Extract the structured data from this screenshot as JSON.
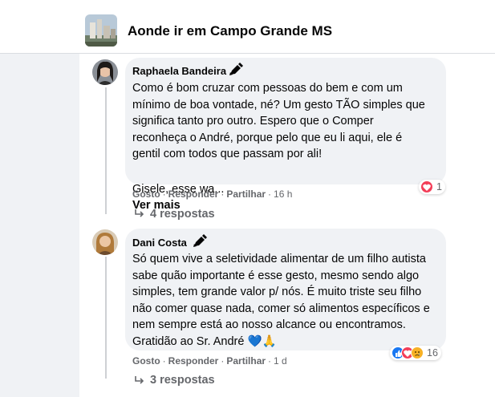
{
  "header": {
    "group_title": "Aonde ir em Campo Grande MS"
  },
  "comments": [
    {
      "author": "Raphaela Bandeira",
      "text": "Como é bom cruzar com pessoas do bem e com um\nmínimo de boa vontade, né? Um gesto TÃO simples que\nsignifica tanto pro outro. Espero que o Comper\nreconheça o André, porque pelo que eu li aqui, ele é\ngentil com todos que passam por ali!",
      "text2": "Gisele, esse wa...",
      "see_more": "Ver mais",
      "actions": {
        "like": "Gosto",
        "reply": "Responder",
        "share": "Partilhar",
        "time": "16 h"
      },
      "reaction_count": "1",
      "reaction_icons": [
        "love-icon"
      ],
      "replies_label": "4 respostas"
    },
    {
      "author": "Dani Costa",
      "text": "Só quem vive a seletividade alimentar de um filho autista\nsabe quão importante é esse gesto, mesmo sendo algo\nsimples, tem grande valor p/ nós. É muito triste seu filho\nnão comer quase nada, comer só alimentos específicos e\nnem sempre está ao nosso alcance ou encontramos.\nGratidão ao Sr. André 💙🙏",
      "actions": {
        "like": "Gosto",
        "reply": "Responder",
        "share": "Partilhar",
        "time": "1 d"
      },
      "reaction_count": "16",
      "reaction_icons": [
        "like-icon",
        "love-icon",
        "sad-icon"
      ],
      "replies_label": "3 respostas"
    }
  ],
  "separator": "·",
  "colors": {
    "accent_blue": "#1877f2",
    "love_red": "#f33e58",
    "sad_yellow": "#f7b125",
    "muted_text": "#65676b",
    "bubble_bg": "#f0f2f5"
  }
}
